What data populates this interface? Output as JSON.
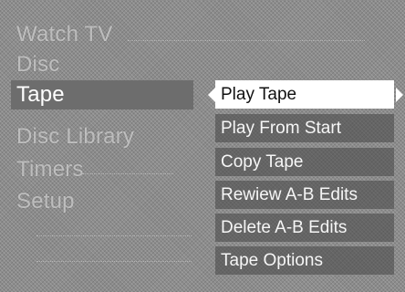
{
  "main_menu": {
    "items": [
      {
        "label": "Watch TV"
      },
      {
        "label": "Disc"
      },
      {
        "label": "Tape"
      },
      {
        "label": "Disc Library"
      },
      {
        "label": "Timers"
      },
      {
        "label": "Setup"
      }
    ],
    "selected": "Tape"
  },
  "sub_menu": {
    "items": [
      {
        "label": "Play Tape"
      },
      {
        "label": "Play From Start"
      },
      {
        "label": "Copy Tape"
      },
      {
        "label": "Rewiew A-B Edits"
      },
      {
        "label": "Delete A-B Edits"
      },
      {
        "label": "Tape Options"
      }
    ],
    "selected": "Play Tape"
  },
  "icons": {
    "left": "arrow-left-icon",
    "right": "arrow-right-icon"
  },
  "colors": {
    "background": "#8c8c8c",
    "selected_main_bg": "#6d6d6d",
    "selected_sub_bg": "#ffffff",
    "sub_item_bg": "#5a5a5a"
  }
}
